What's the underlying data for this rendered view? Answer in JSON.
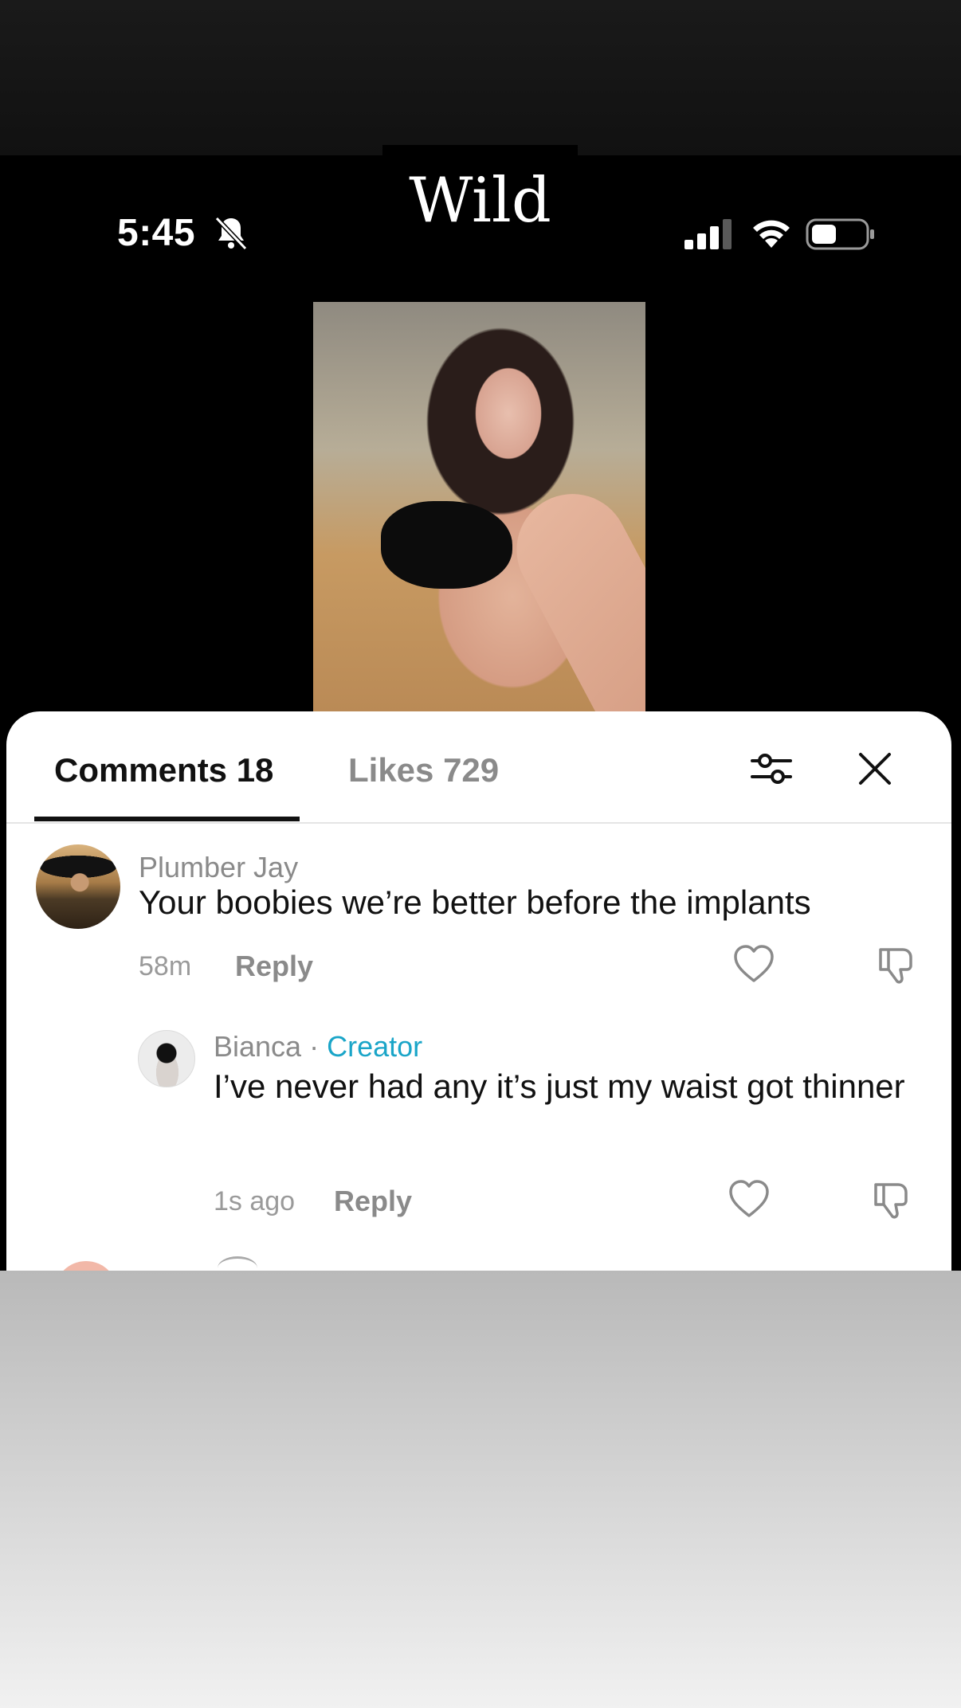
{
  "story": {
    "title": "Wild"
  },
  "status_bar": {
    "time": "5:45",
    "icons": [
      "bell-slash-icon",
      "signal-icon",
      "wifi-icon",
      "battery-icon"
    ]
  },
  "video": {
    "description_icon": "video-thumbnail"
  },
  "tabs": {
    "comments_label": "Comments 18",
    "likes_label": "Likes 729"
  },
  "comments": [
    {
      "username": "Plumber Jay",
      "text": "Your boobies we’re better before the implants",
      "time": "58m",
      "reply_label": "Reply"
    }
  ],
  "replies": [
    {
      "username": "Bianca",
      "separator": " · ",
      "badge": "Creator",
      "text": "I’ve never had any it’s just my waist got thinner",
      "time": "1s ago",
      "reply_label": "Reply"
    }
  ],
  "colors": {
    "creator_badge": "#1aa5c8",
    "muted_text": "#8a8a8a",
    "primary_text": "#111111"
  }
}
